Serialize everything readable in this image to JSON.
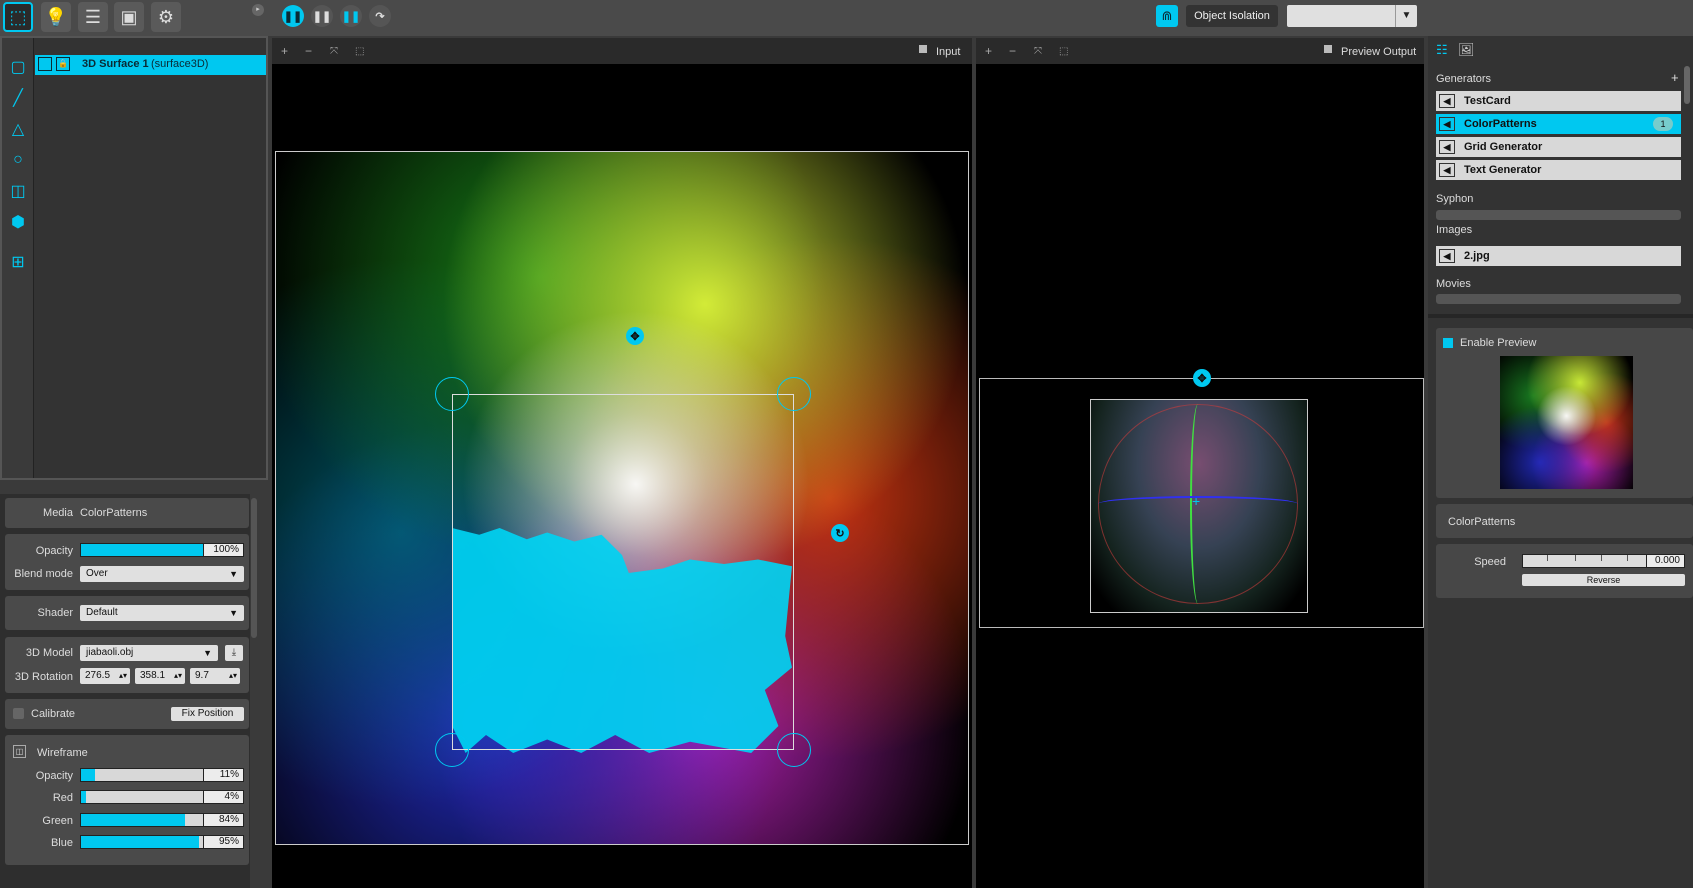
{
  "topbar": {
    "object_isolation_label": "Object Isolation",
    "preset_value": ""
  },
  "layers": {
    "item_name": "3D Surface 1",
    "item_type": "(surface3D)"
  },
  "props": {
    "media_label": "Media",
    "media_value": "ColorPatterns",
    "opacity_label": "Opacity",
    "opacity_value": "100%",
    "opacity_level": 1.0,
    "blend_label": "Blend mode",
    "blend_value": "Over",
    "shader_label": "Shader",
    "shader_value": "Default",
    "model_label": "3D Model",
    "model_value": "jiabaoli.obj",
    "rotation_label": "3D Rotation",
    "rotation": [
      "276.5",
      "358.1",
      "9.7"
    ],
    "calibrate_label": "Calibrate",
    "fix_position_label": "Fix Position",
    "wireframe_label": "Wireframe",
    "wf_opacity_label": "Opacity",
    "wf_opacity_value": "11%",
    "wf_opacity_level": 0.11,
    "red_label": "Red",
    "red_value": "4%",
    "red_level": 0.04,
    "green_label": "Green",
    "green_value": "84%",
    "green_level": 0.84,
    "blue_label": "Blue",
    "blue_value": "95%",
    "blue_level": 0.95
  },
  "input_view": {
    "label": "Input"
  },
  "output_view": {
    "label": "Preview Output"
  },
  "sources": {
    "generators_label": "Generators",
    "generators": [
      {
        "name": "TestCard"
      },
      {
        "name": "ColorPatterns",
        "badge": "1"
      },
      {
        "name": "Grid Generator"
      },
      {
        "name": "Text Generator"
      }
    ],
    "syphon_label": "Syphon",
    "images_label": "Images",
    "images": [
      {
        "name": "2.jpg"
      }
    ],
    "movies_label": "Movies"
  },
  "preview": {
    "enable_label": "Enable Preview",
    "source_name": "ColorPatterns",
    "speed_label": "Speed",
    "speed_value": "0.000",
    "reverse_label": "Reverse"
  },
  "colors": {
    "accent": "#00c8f0"
  }
}
